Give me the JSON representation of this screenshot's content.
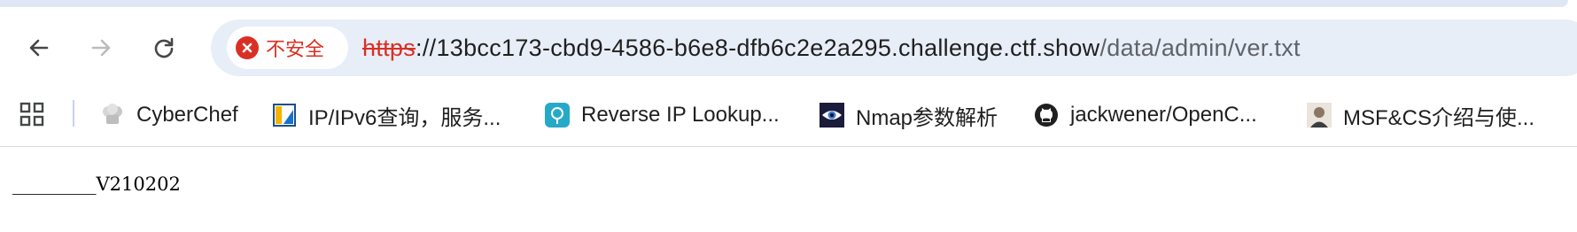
{
  "address_bar": {
    "security_label": "不安全",
    "scheme": "https",
    "host": "://13bcc173-cbd9-4586-b6e8-dfb6c2e2a295.challenge.ctf.show",
    "path": "/data/admin/ver.txt"
  },
  "bookmarks": [
    {
      "label": "CyberChef",
      "icon": "chef-hat-icon"
    },
    {
      "label": "IP/IPv6查询，服务...",
      "icon": "ip-lookup-icon"
    },
    {
      "label": "Reverse IP Lookup...",
      "icon": "map-pin-icon"
    },
    {
      "label": "Nmap参数解析",
      "icon": "eye-icon"
    },
    {
      "label": "jackwener/OpenC...",
      "icon": "github-icon"
    },
    {
      "label": "MSF&CS介绍与使...",
      "icon": "avatar-icon"
    }
  ],
  "page": {
    "text": "_________V210202"
  },
  "colors": {
    "danger": "#d93025",
    "omnibox_bg": "#e8eef8",
    "path_text": "#5f6368"
  }
}
